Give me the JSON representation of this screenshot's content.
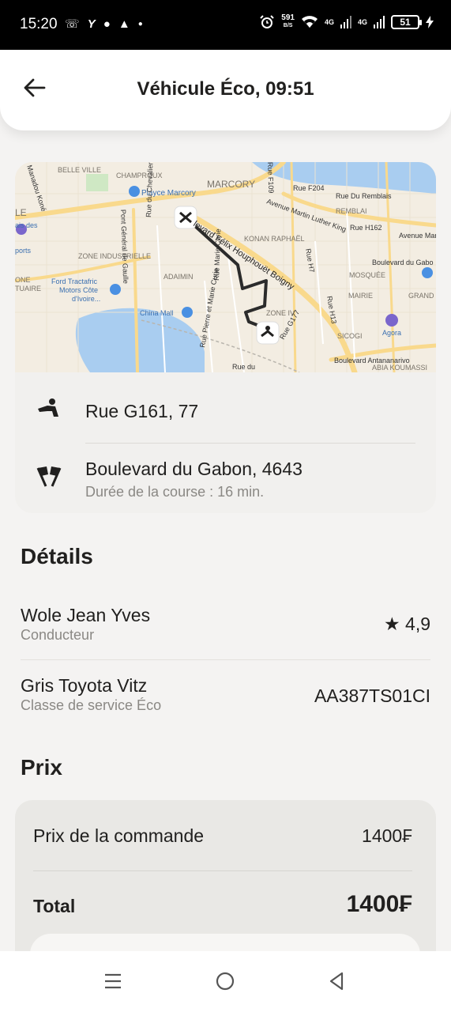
{
  "status_bar": {
    "time": "15:20",
    "speed_value": "591",
    "speed_unit": "B/S",
    "net1": "4G",
    "net2": "4G",
    "battery": "51"
  },
  "header": {
    "title": "Véhicule Éco, 09:51"
  },
  "map": {
    "labels": {
      "belle_ville": "BELLE VILLE",
      "champroux": "CHAMPROUX",
      "marcory": "MARCORY",
      "rue_f109": "Rue F109",
      "rue_f204": "Rue F204",
      "rue_du_remblais": "Rue Du Remblais",
      "remblai": "REMBLAI",
      "rue_h162": "Rue H162",
      "avenue_martin": "Avenue Martin Luther King",
      "avenue_martin2": "Avenue Martin",
      "playce": "Playce Marcory",
      "manadou": "Manadou Koné",
      "pont_general": "Pont Général de Gaulle",
      "rue_chevalier": "Rue du Chevalier de Clieu",
      "bd_felix": "levard Félix Houphouët Boigny",
      "konan": "KONAN RAPHAËL",
      "zone_industrielle": "ZONE INDUSTRIELLE",
      "adaimin": "ADAIMIN",
      "ford": "Ford Tractafric",
      "ford2": "Motors Côte",
      "ford3": "d'Ivoire...",
      "china_mall": "China Mall",
      "zone_iv": "ZONE IV",
      "rue_g177": "Rue G177",
      "rue_h7": "Rue H7",
      "rue_h13": "Rue H13",
      "mosquee": "MOSQUÉE",
      "boulevard_gabon": "Boulevard du Gabo",
      "mairie": "MAIRIE",
      "grand_m": "GRAND M",
      "agora": "Agora",
      "sicogi": "SICOGI",
      "bd_antananarivo": "Boulevard Antananarivo",
      "abia": "ABIA KOUMASSI",
      "pierre_curie": "Rue Pierre et Marie Curie",
      "marie_curie": "Rue Marie Curie",
      "palais": "ais des",
      "sports": "ports",
      "le": "LE",
      "one": "ONE",
      "tuaire": "TUAIRE",
      "rue_du": "Rue du"
    }
  },
  "route": {
    "pickup": "Rue G161, 77",
    "destination": "Boulevard du Gabon, 4643",
    "duration": "Durée de la course : 16 min."
  },
  "details": {
    "title": "Détails",
    "driver_name": "Wole Jean Yves",
    "driver_role": "Conducteur",
    "rating": "★ 4,9",
    "car": "Gris Toyota Vitz",
    "service_class": "Classe de service Éco",
    "plate": "AA387TS01CI"
  },
  "price": {
    "title": "Prix",
    "order_label": "Prix de la commande",
    "order_value": "1400₣",
    "total_label": "Total",
    "total_value": "1400₣"
  },
  "colors": {
    "accent_route": "#2b2b2b",
    "water": "#a9cdf0",
    "road": "#f9d98c",
    "map_bg": "#f3ede2"
  }
}
